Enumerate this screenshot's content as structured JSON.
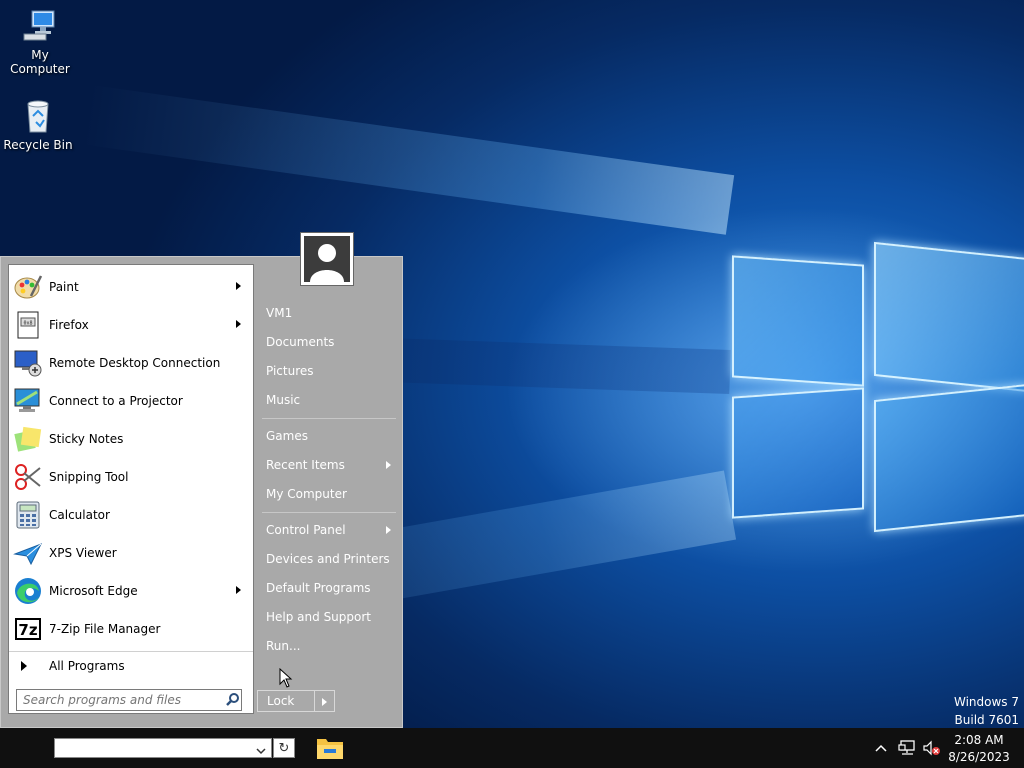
{
  "desktop": {
    "icons": [
      {
        "label": "My Computer"
      },
      {
        "label": "Recycle Bin"
      }
    ]
  },
  "start_menu": {
    "programs": [
      {
        "label": "Paint",
        "icon": "paint-icon",
        "has_submenu": true
      },
      {
        "label": "Firefox",
        "icon": "firefox-icon",
        "has_submenu": true
      },
      {
        "label": "Remote Desktop Connection",
        "icon": "remote-desktop-icon",
        "has_submenu": false
      },
      {
        "label": "Connect to a Projector",
        "icon": "projector-icon",
        "has_submenu": false
      },
      {
        "label": "Sticky Notes",
        "icon": "sticky-notes-icon",
        "has_submenu": false
      },
      {
        "label": "Snipping Tool",
        "icon": "scissors-icon",
        "has_submenu": false
      },
      {
        "label": "Calculator",
        "icon": "calculator-icon",
        "has_submenu": false
      },
      {
        "label": "XPS Viewer",
        "icon": "xps-viewer-icon",
        "has_submenu": false
      },
      {
        "label": "Microsoft Edge",
        "icon": "edge-icon",
        "has_submenu": true
      },
      {
        "label": "7-Zip File Manager",
        "icon": "7zip-icon",
        "has_submenu": false
      }
    ],
    "all_programs_label": "All Programs",
    "search_placeholder": "Search programs and files",
    "right_items": [
      {
        "label": "VM1",
        "has_submenu": false
      },
      {
        "label": "Documents",
        "has_submenu": false
      },
      {
        "label": "Pictures",
        "has_submenu": false
      },
      {
        "label": "Music",
        "has_submenu": false
      },
      {
        "label": "Games",
        "has_submenu": false
      },
      {
        "label": "Recent Items",
        "has_submenu": true
      },
      {
        "label": "My Computer",
        "has_submenu": false
      },
      {
        "label": "Control Panel",
        "has_submenu": true
      },
      {
        "label": "Devices and Printers",
        "has_submenu": false
      },
      {
        "label": "Default Programs",
        "has_submenu": false
      },
      {
        "label": "Help and Support",
        "has_submenu": false
      },
      {
        "label": "Run...",
        "has_submenu": false
      }
    ],
    "lock_label": "Lock"
  },
  "watermark": {
    "line1": "Windows 7",
    "line2": "Build 7601"
  },
  "taskbar": {
    "address_value": "",
    "refresh_glyph": "↻",
    "clock_time": "2:08 AM",
    "clock_date": "8/26/2023"
  },
  "colors": {
    "menu_right_bg": "#a9a9a9",
    "taskbar_bg": "#101010",
    "desktop_accent": "#1d78d6"
  }
}
